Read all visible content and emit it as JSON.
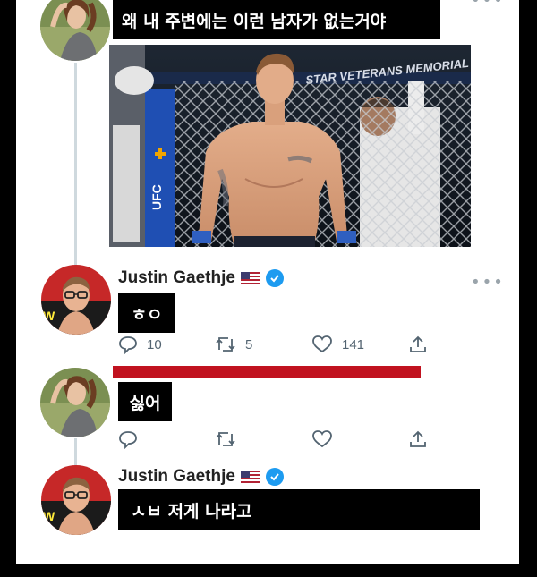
{
  "tweet1": {
    "caption": "왜 내 주변에는 이런 남자가 없는거야",
    "photo_banner": "STAR VETERANS MEMORIAL"
  },
  "tweet2": {
    "author": "Justin Gaethje",
    "caption": "ㅎㅇ",
    "counts": {
      "reply": "10",
      "retweet": "5",
      "like": "141"
    }
  },
  "tweet3": {
    "caption": "싫어"
  },
  "tweet4": {
    "author": "Justin Gaethje",
    "caption": "ㅅㅂ 저게 나라고"
  },
  "colors": {
    "verified": "#1d9bf0",
    "thread_line": "#cfd9de",
    "redaction": "#c1121f",
    "icon_gray": "#536471"
  },
  "icons": [
    "reply-icon",
    "retweet-icon",
    "like-icon",
    "share-icon",
    "verified-icon",
    "us-flag-icon",
    "more-icon"
  ]
}
